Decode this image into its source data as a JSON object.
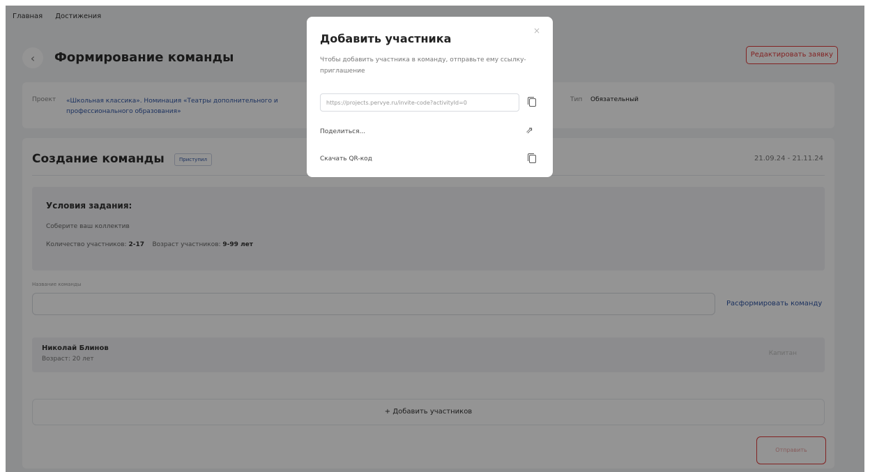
{
  "nav": {
    "home": "Главная",
    "achievements": "Достижения"
  },
  "header": {
    "title": "Формирование команды",
    "edit_button": "Редактировать заявку"
  },
  "project": {
    "label": "Проект",
    "value": "«Школьная классика». Номинация «Театры дополнительного и профессионального образования»",
    "type_label": "Тип",
    "type_value": "Обязательный"
  },
  "section": {
    "title": "Создание команды",
    "status": "Приступил",
    "dates": "21.09.24 - 21.11.24"
  },
  "conditions": {
    "title": "Условия задания:",
    "text": "Соберите ваш коллектив",
    "count_label": "Количество участников:",
    "count_value": "2-17",
    "age_label": "Возраст участников:",
    "age_value": "9-99 лет"
  },
  "team_name": {
    "label": "Название команды",
    "value": "",
    "disband_link": "Расформировать команду"
  },
  "members": [
    {
      "name": "Николай Блинов",
      "age": "Возраст: 20 лет",
      "role": "Капитан"
    }
  ],
  "add_members_button": "+ Добавить участников",
  "submit_button": "Отправить",
  "modal": {
    "title": "Добавить участника",
    "close": "×",
    "description": "Чтобы добавить участника в команду, отправьте ему ссылку-приглашение",
    "invite_link": "https://projects.pervye.ru/invite-code?activityId=0",
    "share": "Поделиться...",
    "download_qr": "Скачать QR-код"
  },
  "colors": {
    "accent_red": "#e03b3b",
    "link_blue": "#2f55a4"
  }
}
